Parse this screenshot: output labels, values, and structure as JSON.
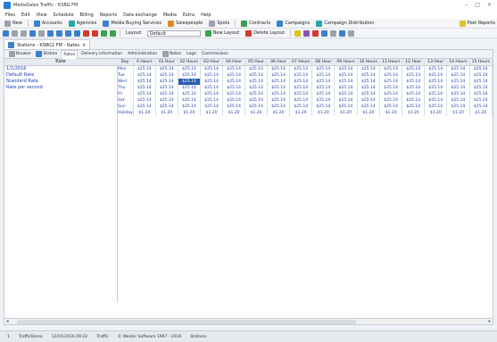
{
  "window": {
    "title": "MediaSales Traffic - KSBG FM",
    "controls": [
      "–",
      "□",
      "×"
    ]
  },
  "menu": [
    "Files",
    "Edit",
    "View",
    "Schedule",
    "Billing",
    "Reports",
    "Data exchange",
    "Media",
    "Extra",
    "Help"
  ],
  "toolbar1": {
    "new": "New",
    "accounts": "Accounts",
    "agencies": "Agencies",
    "media_buying": "Media Buying Services",
    "salespeople": "Salespeople",
    "spots": "Spots",
    "contracts": "Contracts",
    "campaigns": "Campaigns",
    "campaign_distribution": "Campaign Distribution",
    "post_reports": "Post Reports"
  },
  "toolbar2": {
    "layout_label": "Layout:",
    "layout_value": "Default",
    "new_layout": "New Layout",
    "delete_layout": "Delete Layout"
  },
  "doc_tab": {
    "label": "Stations - KSBG1 FM - Rates",
    "close": "×"
  },
  "subtabs": [
    "Browse",
    "Station",
    "Rates",
    "Delivery information",
    "Administration",
    "Notes",
    "Logo",
    "Commissions"
  ],
  "active_subtab": "Rates",
  "rate_panel": {
    "header": "Rate",
    "items": [
      "1/1/2016",
      "Default Rate",
      "Standard Rate",
      "Rate per second"
    ]
  },
  "grid": {
    "headers": [
      "Day",
      "0 Hours",
      "01 Hour",
      "02 Hours",
      "03 Hour",
      "04 Hour",
      "05 Hour",
      "06 Hour",
      "07 Hours",
      "08 Hour",
      "09 Hours",
      "10 Hours",
      "11 Hours",
      "12 Hour",
      "13 Hour",
      "14 Hours",
      "15 Hours"
    ],
    "rows": [
      {
        "day": "Mon",
        "values": [
          "$25.14",
          "$25.14",
          "$25.14",
          "$25.14",
          "$25.14",
          "$25.14",
          "$25.14",
          "$25.14",
          "$25.14",
          "$25.14",
          "$25.14",
          "$25.14",
          "$25.14",
          "$25.14",
          "$25.14",
          "$25.14"
        ]
      },
      {
        "day": "Tue",
        "values": [
          "$25.14",
          "$25.14",
          "$25.14",
          "$25.14",
          "$25.14",
          "$25.14",
          "$25.14",
          "$25.14",
          "$25.14",
          "$25.14",
          "$25.14",
          "$25.14",
          "$25.14",
          "$25.14",
          "$25.14",
          "$25.14"
        ]
      },
      {
        "day": "Wed",
        "values": [
          "$25.14",
          "$25.14",
          "$25.14",
          "$25.14",
          "$25.14",
          "$25.14",
          "$25.14",
          "$25.14",
          "$25.14",
          "$25.14",
          "$25.14",
          "$25.14",
          "$25.14",
          "$25.14",
          "$25.14",
          "$25.14"
        ]
      },
      {
        "day": "Thu",
        "values": [
          "$25.14",
          "$25.14",
          "$25.14",
          "$25.14",
          "$25.14",
          "$25.14",
          "$25.14",
          "$25.14",
          "$25.14",
          "$25.14",
          "$25.14",
          "$25.14",
          "$25.14",
          "$25.14",
          "$25.14",
          "$25.14"
        ]
      },
      {
        "day": "Fri",
        "values": [
          "$25.14",
          "$25.14",
          "$25.14",
          "$25.14",
          "$25.14",
          "$25.14",
          "$25.14",
          "$25.14",
          "$25.14",
          "$25.14",
          "$25.14",
          "$25.14",
          "$25.14",
          "$25.14",
          "$25.14",
          "$25.14"
        ]
      },
      {
        "day": "Sat",
        "values": [
          "$25.14",
          "$25.14",
          "$25.14",
          "$25.14",
          "$25.14",
          "$25.14",
          "$25.14",
          "$25.14",
          "$25.14",
          "$25.14",
          "$25.14",
          "$25.14",
          "$25.14",
          "$25.14",
          "$25.14",
          "$25.14"
        ]
      },
      {
        "day": "Sun",
        "values": [
          "$25.14",
          "$25.14",
          "$25.14",
          "$25.14",
          "$25.14",
          "$25.14",
          "$25.14",
          "$25.14",
          "$25.14",
          "$25.14",
          "$25.14",
          "$25.14",
          "$25.14",
          "$25.14",
          "$25.14",
          "$25.14"
        ]
      },
      {
        "day": "Holiday",
        "values": [
          "$1.20",
          "$1.20",
          "$1.20",
          "$1.20",
          "$1.20",
          "$1.20",
          "$1.20",
          "$1.20",
          "$1.20",
          "$1.20",
          "$1.20",
          "$1.20",
          "$1.20",
          "$1.20",
          "$1.20",
          "$1.20"
        ]
      }
    ],
    "selected": {
      "row": 2,
      "col": 2
    }
  },
  "scrollbar": {
    "left": "◂",
    "right": "▸"
  },
  "status": [
    "1",
    "TrafficDemo",
    "12/01/2016 09:22",
    "Traffic",
    "© Weider Software 1997 - 2016",
    "Stations"
  ]
}
